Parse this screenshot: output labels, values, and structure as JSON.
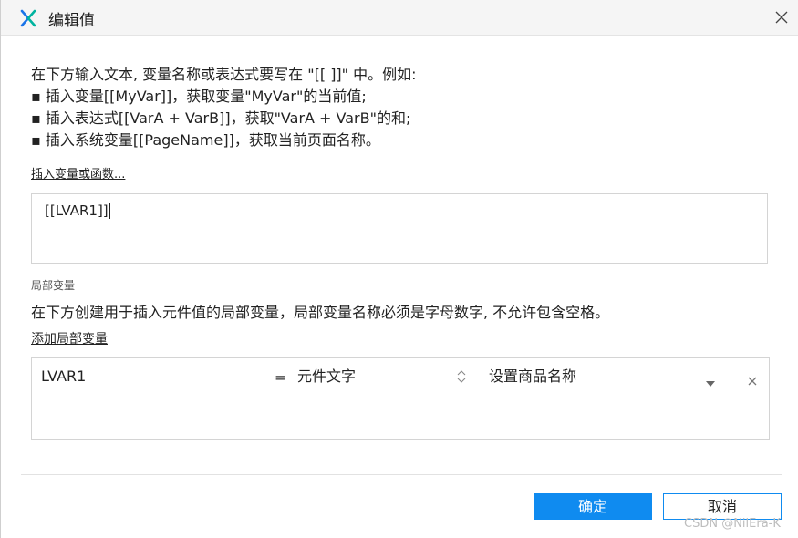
{
  "window": {
    "title": "编辑值",
    "app_icon": "axure-x-logo-icon",
    "close_icon": "close-icon"
  },
  "intro": {
    "line1": "在下方输入文本, 变量名称或表达式要写在 \"[[ ]]\" 中。例如:",
    "line2": "▪ 插入变量[[MyVar]]，获取变量\"MyVar\"的当前值;",
    "line3": "▪ 插入表达式[[VarA + VarB]]，获取\"VarA + VarB\"的和;",
    "line4": "▪ 插入系统变量[[PageName]]，获取当前页面名称。"
  },
  "insert_link": "插入变量或函数...",
  "expression_value": "[[LVAR1]]",
  "local_vars": {
    "section_label": "局部变量",
    "description": "在下方创建用于插入元件值的局部变量，局部变量名称必须是字母数字, 不允许包含空格。",
    "add_link": "添加局部变量",
    "rows": [
      {
        "name": "LVAR1",
        "equals": "=",
        "type": "元件文字",
        "target": "设置商品名称"
      }
    ]
  },
  "buttons": {
    "ok": "确定",
    "cancel": "取消"
  },
  "watermark": "CSDN @NilEra-K",
  "colors": {
    "primary": "#0f8bf0",
    "logo_blue": "#1a73e8",
    "logo_teal": "#00b39f"
  }
}
